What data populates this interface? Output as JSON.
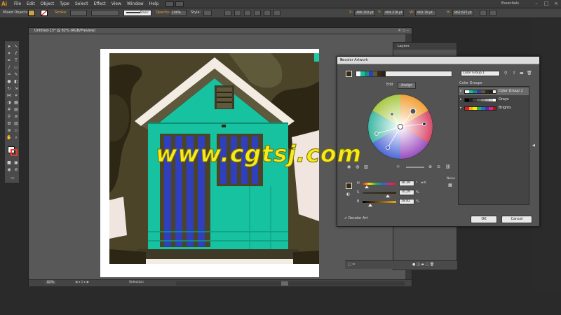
{
  "menubar": {
    "app_logo": "Ai",
    "items": [
      "File",
      "Edit",
      "Object",
      "Type",
      "Select",
      "Effect",
      "View",
      "Window",
      "Help"
    ],
    "workspace": "Essentials"
  },
  "controlbar": {
    "selection_label": "Mixed Objects",
    "stroke_label": "Stroke:",
    "brush_label": "Basic",
    "opacity_label": "Opacity:",
    "opacity_value": "100%",
    "style_label": "Style:",
    "x_value": "486.202 pt",
    "y_value": "494.378 pt",
    "w_value": "902.78 pt",
    "h_value": "862.627 pt",
    "x_label": "X:",
    "y_label": "Y:",
    "w_label": "W:",
    "h_label": "H:"
  },
  "document": {
    "tab_label": "Untitled-13* @ 82% (RGB/Preview)",
    "zoom": "82%",
    "status_text": "Selection"
  },
  "layers": {
    "tab_label": "Layers"
  },
  "recolor": {
    "title": "Recolor Artwork",
    "color_group_name": "Color Group 1",
    "tab_edit": "Edit",
    "tab_assign": "Assign",
    "color_groups_label": "Color Groups",
    "groups": [
      {
        "name": "Color Group 1"
      },
      {
        "name": "Grays"
      },
      {
        "name": "Brights"
      }
    ],
    "h_label": "H",
    "s_label": "S",
    "b_label": "B",
    "h_value": "36.39",
    "s_value": "70.29",
    "b_value": "18.82",
    "h_unit": "°",
    "s_unit": "%",
    "b_unit": "%",
    "none_label": "None",
    "recolor_art_label": "Recolor Art",
    "ok_label": "OK",
    "cancel_label": "Cancel"
  },
  "watermark": "www.cgtsj.com",
  "colors": {
    "accent_orange": "#f7a41c",
    "teal": "#17c2a0",
    "stripe_blue": "#2f3fbd",
    "base_swatch": "#3a2a12"
  }
}
